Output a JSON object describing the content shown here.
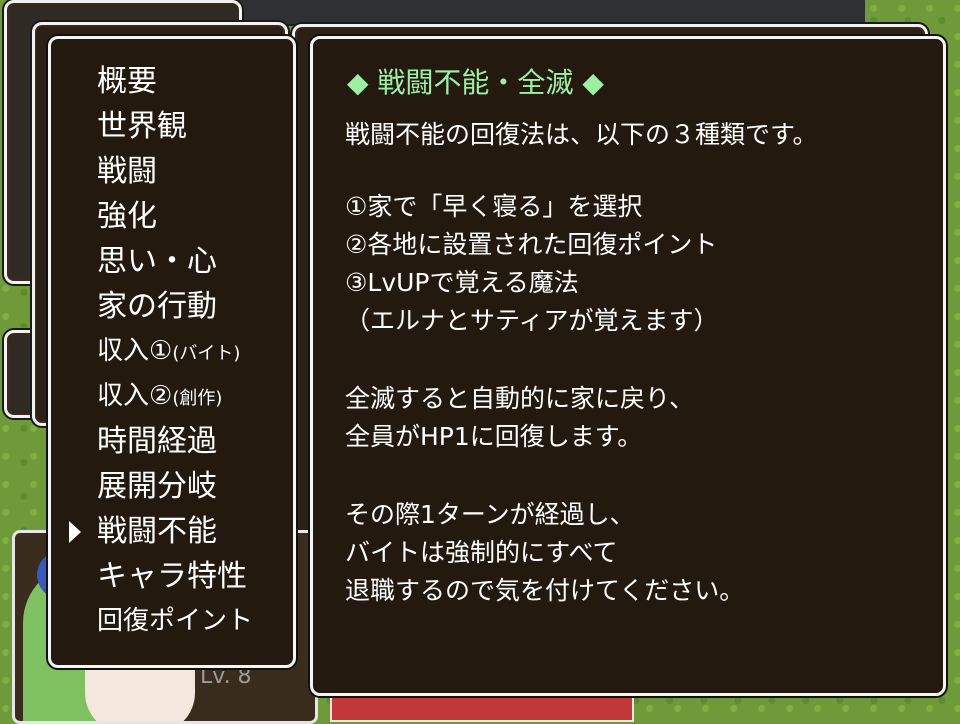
{
  "level": "Lv. 8",
  "menu": {
    "items": [
      {
        "label": "概要"
      },
      {
        "label": "世界観"
      },
      {
        "label": "戦闘"
      },
      {
        "label": "強化"
      },
      {
        "label": "思い・心"
      },
      {
        "label": "家の行動"
      },
      {
        "label": "収入①",
        "suffix": "(バイト)"
      },
      {
        "label": "収入②",
        "suffix": "(創作)"
      },
      {
        "label": "時間経過"
      },
      {
        "label": "展開分岐"
      },
      {
        "label": "戦闘不能",
        "selected": true
      },
      {
        "label": "キャラ特性"
      },
      {
        "label": "回復ポイント"
      }
    ]
  },
  "content": {
    "title": "◆ 戦闘不能・全滅 ◆",
    "lines": [
      "戦闘不能の回復法は、以下の３種類です。",
      "",
      "①家で「早く寝る」を選択",
      "②各地に設置された回復ポイント",
      "③LvUPで覚える魔法",
      "（エルナとサティアが覚えます）",
      "",
      "全滅すると自動的に家に戻り、",
      "全員がHP1に回復します。",
      "",
      "その際1ターンが経過し、",
      "バイトは強制的にすべて",
      "退職するので気を付けてください。"
    ]
  },
  "colors": {
    "window_bg": "#24190f",
    "title_green": "#9bf0a4",
    "text": "#ffffff"
  }
}
